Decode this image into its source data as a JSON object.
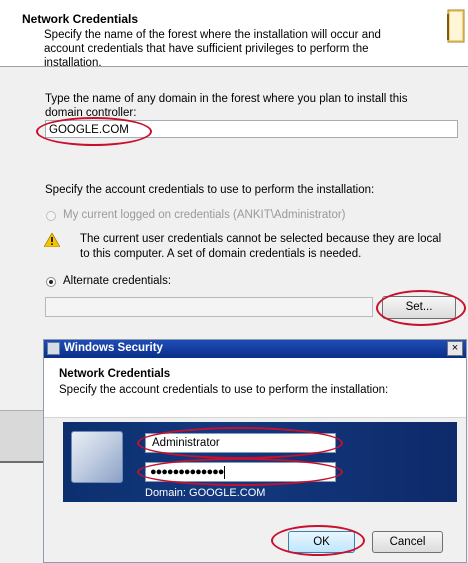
{
  "wizard": {
    "title": "Network Credentials",
    "subtitle": "Specify the name of the forest where the installation will occur and account credentials that have sufficient privileges to perform the installation.",
    "domain_label": "Type the name of any domain in the forest where you plan to install this domain controller:",
    "domain_value": "GOOGLE.COM",
    "account_label": "Specify the account credentials to use to perform the installation:",
    "option_current": "My current logged on credentials (ANKIT\\Administrator)",
    "warning_text": "The current user credentials cannot be selected because they are local to this computer. A set of domain credentials is needed.",
    "option_alternate": "Alternate credentials:",
    "alternate_value": "",
    "set_button": "Set..."
  },
  "security_dialog": {
    "title": "Windows Security",
    "close_label": "×",
    "heading": "Network Credentials",
    "subtitle": "Specify the account credentials to use to perform the installation:",
    "username": "Administrator",
    "password_mask": "●●●●●●●●●●●●●",
    "domain_note": "Domain: GOOGLE.COM",
    "ok_button": "OK",
    "cancel_button": "Cancel"
  },
  "colors": {
    "annotation": "#c8102e",
    "title_bar": "#1f4db5",
    "credential_panel": "#12397f"
  }
}
